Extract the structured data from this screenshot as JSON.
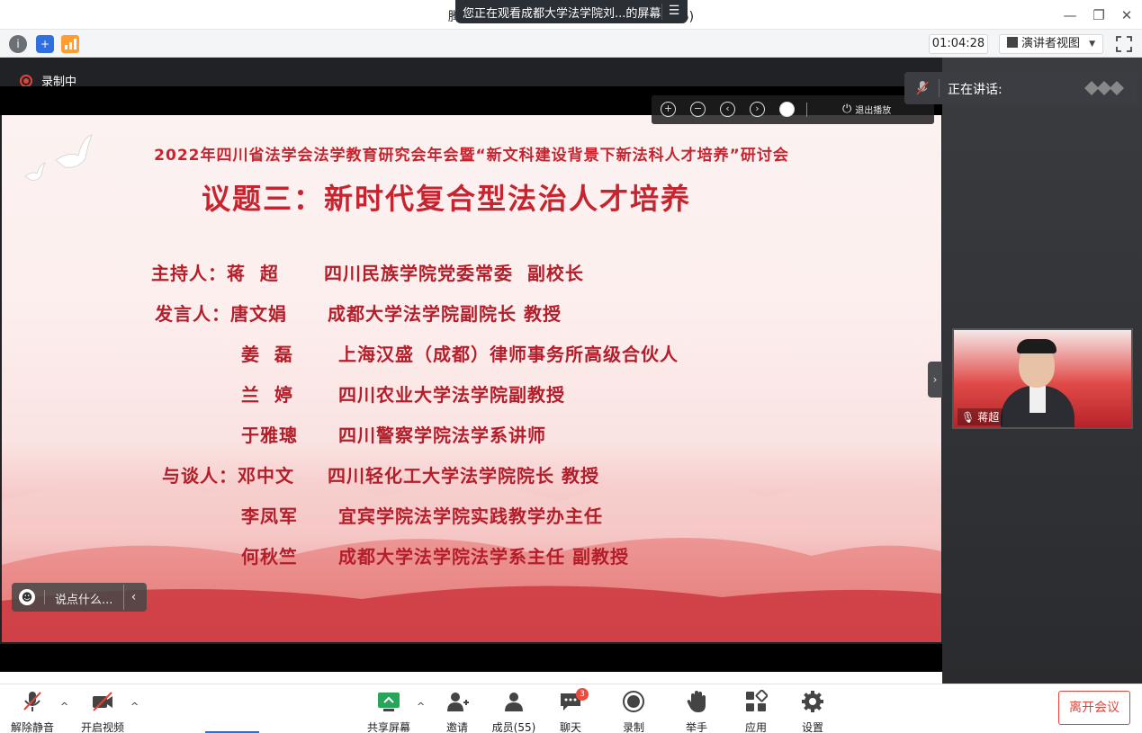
{
  "window": {
    "title": "腾讯会议",
    "title_suffix": "3456)",
    "share_banner": "您正在观看成都大学法学院刘...的屏幕"
  },
  "infobar": {
    "elapsed": "01:04:28",
    "view_mode": "演讲者视图"
  },
  "stage": {
    "recording_label": "录制中",
    "player": {
      "exit_label": "退出播放"
    },
    "chat_placeholder": "说点什么..."
  },
  "slide": {
    "subtitle": "2022年四川省法学会法学教育研究会年会暨“新文科建设背景下新法科人才培养”研讨会",
    "title": "议题三：新时代复合型法治人才培养",
    "lines": [
      {
        "role": "主持人：",
        "name": "蒋  超",
        "desc": "四川民族学院党委常委  副校长"
      },
      {
        "role": "发言人：",
        "name": "唐文娟",
        "desc": "成都大学法学院副院长 教授"
      },
      {
        "role": "",
        "name": "姜  磊",
        "desc": "上海汉盛（成都）律师事务所高级合伙人"
      },
      {
        "role": "",
        "name": "兰  婷",
        "desc": "四川农业大学法学院副教授"
      },
      {
        "role": "",
        "name": "于雅璁",
        "desc": "四川警察学院法学系讲师"
      },
      {
        "role": "与谈人：",
        "name": "邓中文",
        "desc": "四川轻化工大学法学院院长 教授"
      },
      {
        "role": "",
        "name": "李凤军",
        "desc": "宜宾学院法学院实践教学办主任"
      },
      {
        "role": "",
        "name": "何秋竺",
        "desc": "成都大学法学院法学系主任 副教授"
      }
    ]
  },
  "right_panel": {
    "speaking_label": "正在讲话:",
    "thumb_name": "蒋超"
  },
  "toolbar": {
    "unmute": "解除静音",
    "video": "开启视频",
    "share": "共享屏幕",
    "invite": "邀请",
    "members": "成员(55)",
    "chat": "聊天",
    "chat_badge": "3",
    "record": "录制",
    "raise_hand": "举手",
    "apps": "应用",
    "settings": "设置",
    "leave": "离开会议"
  }
}
